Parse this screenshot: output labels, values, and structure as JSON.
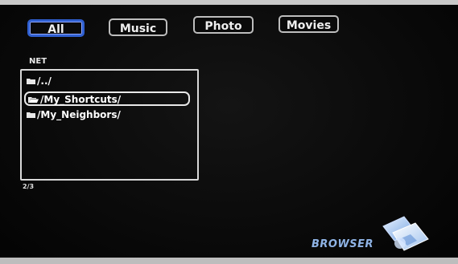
{
  "tabs": [
    {
      "label": "All",
      "active": true
    },
    {
      "label": "Music",
      "active": false
    },
    {
      "label": "Photo",
      "active": false
    },
    {
      "label": "Movies",
      "active": false
    }
  ],
  "location": "NET",
  "items": [
    {
      "label": "/../",
      "selected": false
    },
    {
      "label": "/My_Shortcuts/",
      "selected": true
    },
    {
      "label": "/My_Neighbors/",
      "selected": false
    }
  ],
  "page_indicator": "2/3",
  "branding": {
    "label": "BROWSER",
    "icon": "browser-folders-icon"
  },
  "colors": {
    "active_tab_border": "#2f5fd0",
    "background": "#0a0a0a",
    "brand_text": "#8fb4e6"
  }
}
